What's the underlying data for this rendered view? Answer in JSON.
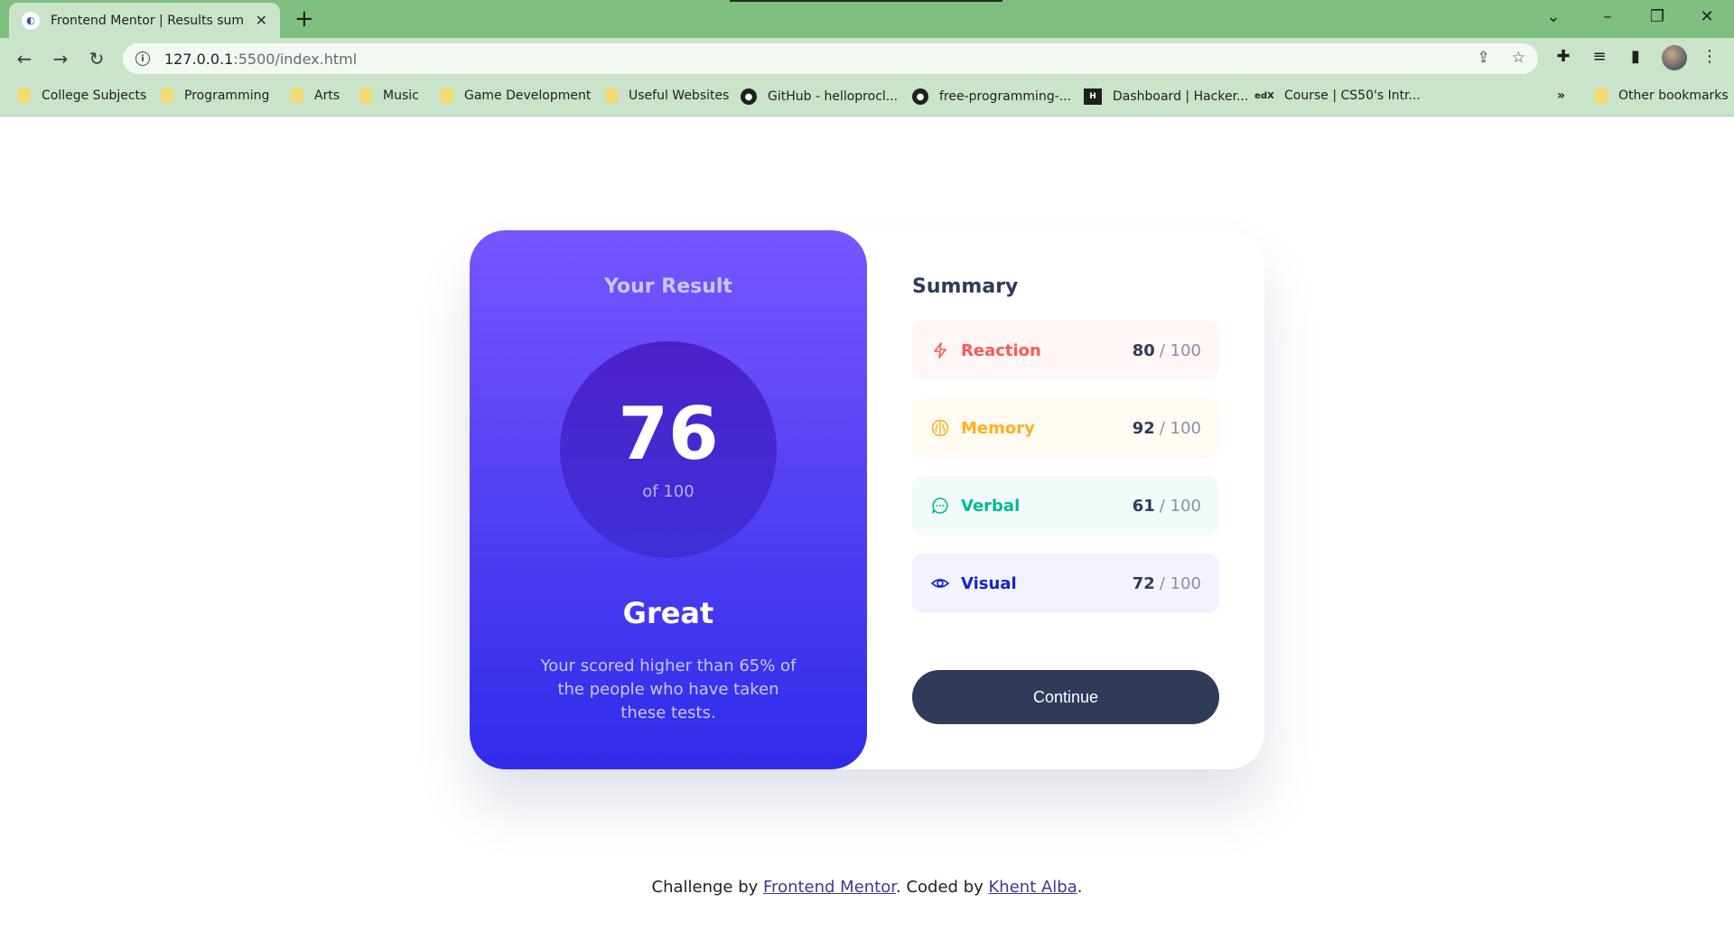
{
  "browser": {
    "tab_title": "Frontend Mentor | Results summ",
    "url_host": "127.0.0.1",
    "url_path": ":5500/index.html",
    "bookmarks": [
      {
        "label": "College Subjects",
        "icon": "folder-icon"
      },
      {
        "label": "Programming",
        "icon": "folder-icon"
      },
      {
        "label": "Arts",
        "icon": "folder-icon"
      },
      {
        "label": "Music",
        "icon": "folder-icon"
      },
      {
        "label": "Game Development",
        "icon": "folder-icon"
      },
      {
        "label": "Useful Websites",
        "icon": "folder-icon"
      },
      {
        "label": "GitHub - helloprocl...",
        "icon": "github-icon"
      },
      {
        "label": "free-programming-...",
        "icon": "github-icon"
      },
      {
        "label": "Dashboard | Hacker...",
        "icon": "hackerrank-icon"
      },
      {
        "label": "Course | CS50's Intr...",
        "icon": "edx-icon"
      }
    ],
    "more_bookmarks": "»",
    "other_bookmarks": "Other bookmarks"
  },
  "result": {
    "heading": "Your Result",
    "score": "76",
    "of_label": "of 100",
    "rating": "Great",
    "description": "Your scored higher than 65% of the people who have taken these tests."
  },
  "summary": {
    "title": "Summary",
    "categories": [
      {
        "label": "Reaction",
        "score": "80",
        "max": "/ 100",
        "color": "#ff5757",
        "bg": "#fff6f5",
        "icon": "lightning-icon"
      },
      {
        "label": "Memory",
        "score": "92",
        "max": "/ 100",
        "color": "#ffb01f",
        "bg": "#fffbf2",
        "icon": "brain-icon"
      },
      {
        "label": "Verbal",
        "score": "61",
        "max": "/ 100",
        "color": "#00bb8f",
        "bg": "#f2fbfa",
        "icon": "chat-bubble-icon"
      },
      {
        "label": "Visual",
        "score": "72",
        "max": "/ 100",
        "color": "#1125d4",
        "bg": "#f3f3fd",
        "icon": "eye-icon"
      }
    ],
    "continue_label": "Continue"
  },
  "footer": {
    "prefix": "Challenge by ",
    "link1": "Frontend Mentor",
    "middle": ". Coded by ",
    "link2": "Khent Alba",
    "suffix": "."
  }
}
